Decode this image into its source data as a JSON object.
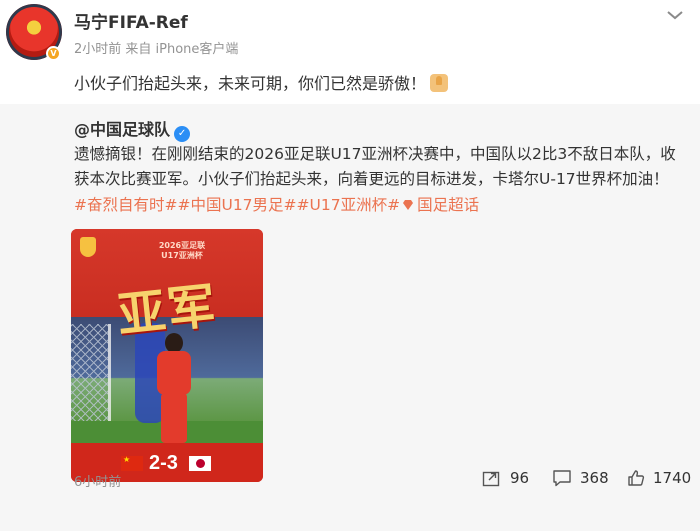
{
  "post": {
    "author": "马宁FIFA-Ref",
    "meta": "2小时前  来自 iPhone客户端",
    "text": "小伙子们抬起头来，未来可期，你们已然是骄傲！"
  },
  "repost": {
    "author": "@中国足球队",
    "text_lines": [
      "遗憾摘银！在刚刚结束的2026亚足联U17亚洲杯决赛中，中国队以2比3不敌日本队，收",
      "获本次比赛亚军。小伙子们抬起头来，向着更远的目标进发，卡塔尔U-17世界杯加油！"
    ],
    "tags": [
      "#奋烈自有时#",
      "#中国U17男足#",
      "#U17亚洲杯#"
    ],
    "tag_link": "国足超话",
    "poster": {
      "small_title_1": "2026亚足联",
      "small_title_2": "U17亚洲杯",
      "big_title": "亚军",
      "score": "2-3"
    },
    "time": "6小时前",
    "repost_count": "96",
    "comment_count": "368",
    "like_count": "1740"
  },
  "colors": {
    "tag": "#eb7350",
    "verified_blue": "#2b8ef5",
    "verified_gold": "#f5a623",
    "repost_bg": "#f6f6f6"
  },
  "icons": [
    "chevron-down-icon",
    "verified-icon",
    "thumbs-up-emoji-icon",
    "supertopic-icon",
    "repost-icon",
    "comment-icon",
    "like-icon"
  ]
}
